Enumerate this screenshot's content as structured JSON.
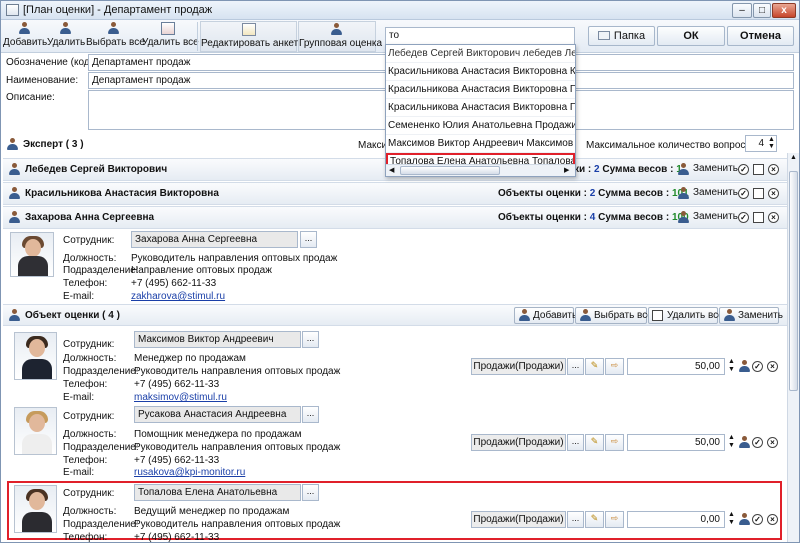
{
  "window": {
    "title": "[План оценки] - Департамент продаж",
    "minimize_label": "–",
    "maximize_label": "□",
    "close_label": "x"
  },
  "toolbar": {
    "add_label": "Добавить",
    "delete_label": "Удалить",
    "select_all_label": "Выбрать все",
    "delete_all_label": "Удалить все",
    "edit_form_label": "Редактировать анкету",
    "group_eval_label": "Групповая оценка",
    "folder_label": "Папка",
    "ok_label": "ОК",
    "cancel_label": "Отмена"
  },
  "search": {
    "value": "то",
    "results": [
      "Лебедев Сергей Викторович лебедев Лебедев",
      "Красильникова Анастасия Викторовна Красильн",
      "Красильникова Анастасия Викторовна Продажи",
      "Красильникова Анастасия Викторовна Продажи",
      "Семененко Юлия  Анатольевна Продажи(Прод",
      "Максимов Виктор Андреевич Максимов Мак",
      "Топалова Елена Анатольевна Топалова  Топ"
    ]
  },
  "form": {
    "code_label": "Обозначение (код):",
    "code_value": "Департамент продаж",
    "name_label": "Наименование:",
    "name_value": "Департамент продаж",
    "desc_label": "Описание:",
    "desc_value": ""
  },
  "experts": {
    "header": "Эксперт ( 3 )",
    "max_partial": "Макси",
    "max_questions_label": "Максимальное количество вопросов :",
    "max_questions_value": "4",
    "stats_partial": "ки : 2 Сумма весов : 1",
    "replace_label": "Заменить",
    "list": [
      {
        "name": "Лебедев Сергей Викторович"
      },
      {
        "name": "Красильникова Анастасия Викторовна",
        "objects_label": "Объекты оценки :",
        "objects_count": "2",
        "weights_label": "Сумма весов :",
        "weights_sum": "101"
      },
      {
        "name": "Захарова Анна Сергеевна",
        "objects_label": "Объекты оценки :",
        "objects_count": "4",
        "weights_label": "Сумма весов :",
        "weights_sum": "100"
      }
    ],
    "detail": {
      "employee_label": "Сотрудник:",
      "employee": "Захарова Анна Сергеевна",
      "position_label": "Должность:",
      "position": "Руководитель направления оптовых продаж",
      "dept_label": "Подразделение:",
      "dept": "Направление оптовых продаж",
      "phone_label": "Телефон:",
      "phone": "+7 (495) 662-11-33",
      "email_label": "E-mail:",
      "email": "zakharova@stimul.ru"
    }
  },
  "objects": {
    "header": "Объект оценки ( 4 )",
    "add_label": "Добавить",
    "select_all_label": "Выбрать все",
    "delete_all_label": "Удалить все",
    "replace_label": "Заменить",
    "labels": {
      "employee": "Сотрудник:",
      "position": "Должность:",
      "dept": "Подразделение:",
      "phone": "Телефон:",
      "email": "E-mail:"
    },
    "list": [
      {
        "employee": "Максимов Виктор Андреевич",
        "position": "Менеджер по продажам",
        "dept": "Руководитель направления оптовых продаж",
        "phone": "+7 (495) 662-11-33",
        "email": "maksimov@stimul.ru",
        "group": "Продажи(Продажи)",
        "weight": "50,00"
      },
      {
        "employee": "Русакова Анастасия Андреевна",
        "position": "Помощник менеджера по продажам",
        "dept": "Руководитель направления оптовых продаж",
        "phone": "+7 (495) 662-11-33",
        "email": "rusakova@kpi-monitor.ru",
        "group": "Продажи(Продажи)",
        "weight": "50,00"
      },
      {
        "employee": "Топалова Елена Анатольевна",
        "position": "Ведущий менеджер по продажам",
        "dept": "Руководитель направления оптовых продаж",
        "phone": "+7 (495) 662-11-33",
        "email": "",
        "group": "Продажи(Продажи)",
        "weight": "0,00"
      }
    ]
  },
  "ellipsis": "...",
  "colors": {
    "highlight": "#e0202a",
    "blue_value": "#1a3fa8",
    "green_value": "#1f8a29"
  }
}
